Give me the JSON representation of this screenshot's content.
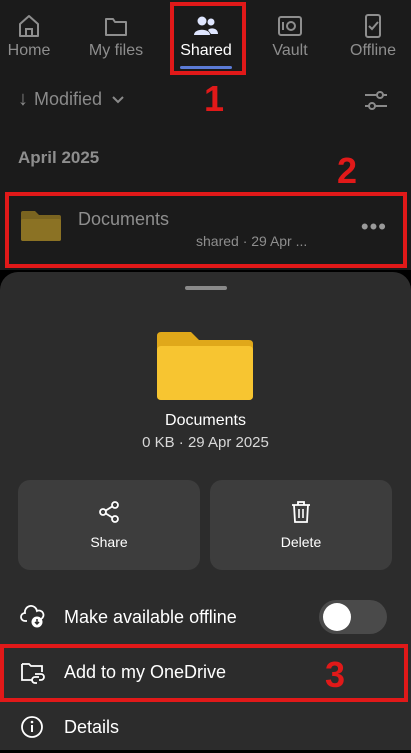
{
  "nav": {
    "tabs": [
      {
        "label": "Home",
        "icon": "home-icon"
      },
      {
        "label": "My files",
        "icon": "folder-icon"
      },
      {
        "label": "Shared",
        "icon": "people-icon",
        "active": true
      },
      {
        "label": "Vault",
        "icon": "vault-icon"
      },
      {
        "label": "Offline",
        "icon": "offline-phone-icon"
      }
    ]
  },
  "sort": {
    "arrow": "↓",
    "label": "Modified"
  },
  "section": {
    "title": "April 2025"
  },
  "row": {
    "name": "Documents",
    "meta": "shared · 29 Apr ...",
    "more": "•••"
  },
  "sheet": {
    "name": "Documents",
    "meta": "0 KB · 29 Apr 2025",
    "share_label": "Share",
    "delete_label": "Delete",
    "items": [
      {
        "label": "Make available offline",
        "toggle_on": false
      },
      {
        "label": "Add to my OneDrive"
      },
      {
        "label": "Details"
      }
    ]
  },
  "annotations": [
    "1",
    "2",
    "3"
  ],
  "colors": {
    "accent": "#5b7bd6",
    "annotation": "#e11919",
    "folder": "#f7c531"
  }
}
